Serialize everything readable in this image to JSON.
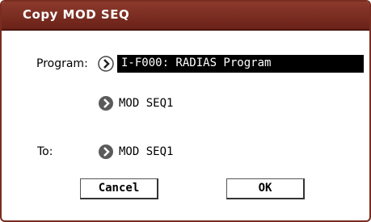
{
  "dialog": {
    "title": "Copy MOD SEQ"
  },
  "program": {
    "label": "Program:",
    "value": "I-F000: RADIAS Program"
  },
  "source": {
    "value": "MOD SEQ1"
  },
  "destination": {
    "label": "To:",
    "value": "MOD SEQ1"
  },
  "buttons": {
    "cancel": "Cancel",
    "ok": "OK"
  },
  "colors": {
    "titlebar": "#7a2c20",
    "selected_field_bg": "#000000",
    "arrow_icon": "#5a5a5a"
  },
  "icons": {
    "program_arrow": "chevron-right-icon",
    "source_arrow": "chevron-right-icon",
    "destination_arrow": "chevron-right-icon"
  }
}
